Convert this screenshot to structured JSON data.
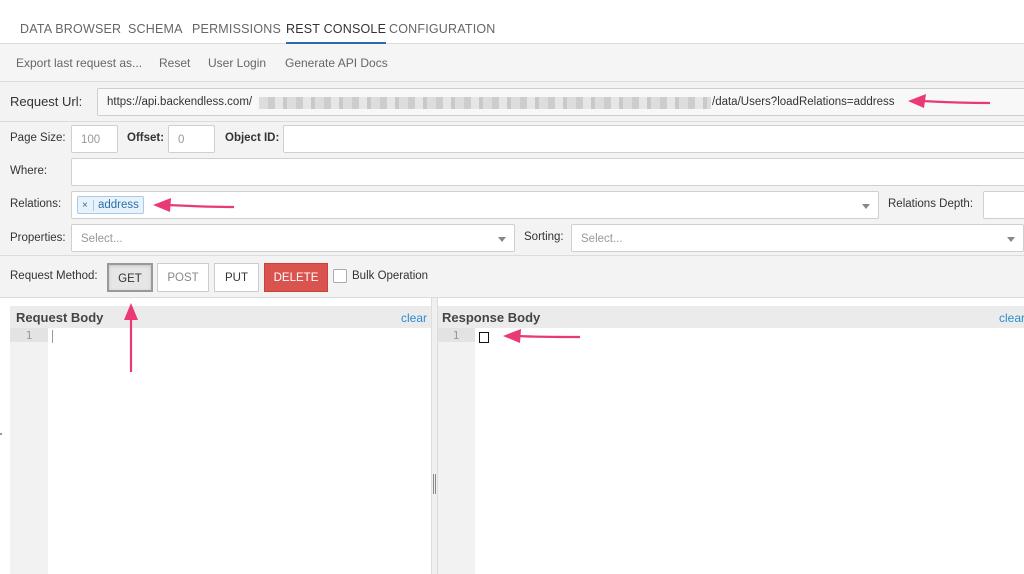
{
  "nav": {
    "tabs": [
      {
        "label": "DATA BROWSER"
      },
      {
        "label": "SCHEMA"
      },
      {
        "label": "PERMISSIONS"
      },
      {
        "label": "REST CONSOLE",
        "active": true
      },
      {
        "label": "CONFIGURATION"
      }
    ],
    "accent_color": "#2b6cb0"
  },
  "subnav": {
    "items": [
      {
        "label": "Export last request as..."
      },
      {
        "label": "Reset"
      },
      {
        "label": "User Login"
      },
      {
        "label": "Generate API Docs"
      }
    ]
  },
  "request_url": {
    "label": "Request Url:",
    "prefix": "https://api.backendless.com/",
    "suffix": "/data/Users?loadRelations=address"
  },
  "params": {
    "page_size": {
      "label": "Page Size:",
      "value": "100"
    },
    "offset": {
      "label": "Offset:",
      "value": "0"
    },
    "object_id": {
      "label": "Object ID:",
      "value": ""
    },
    "where": {
      "label": "Where:",
      "value": ""
    },
    "relations": {
      "label": "Relations:",
      "tags": [
        {
          "remove": "×",
          "label": "address"
        }
      ]
    },
    "relations_depth": {
      "label": "Relations Depth:",
      "value": ""
    },
    "properties": {
      "label": "Properties:",
      "placeholder": "Select..."
    },
    "sorting": {
      "label": "Sorting:",
      "placeholder": "Select..."
    }
  },
  "method": {
    "label": "Request Method:",
    "buttons": {
      "get": "GET",
      "post": "POST",
      "put": "PUT",
      "delete": "DELETE"
    },
    "selected": "GET",
    "bulk_label": "Bulk Operation",
    "bulk_checked": false,
    "delete_color": "#d9534f"
  },
  "request_body": {
    "title": "Request Body",
    "clear": "clear",
    "line_number": "1"
  },
  "response_body": {
    "title": "Response Body",
    "clear": "clear",
    "line_number": "1"
  },
  "annotation_color": "#ea3a73"
}
